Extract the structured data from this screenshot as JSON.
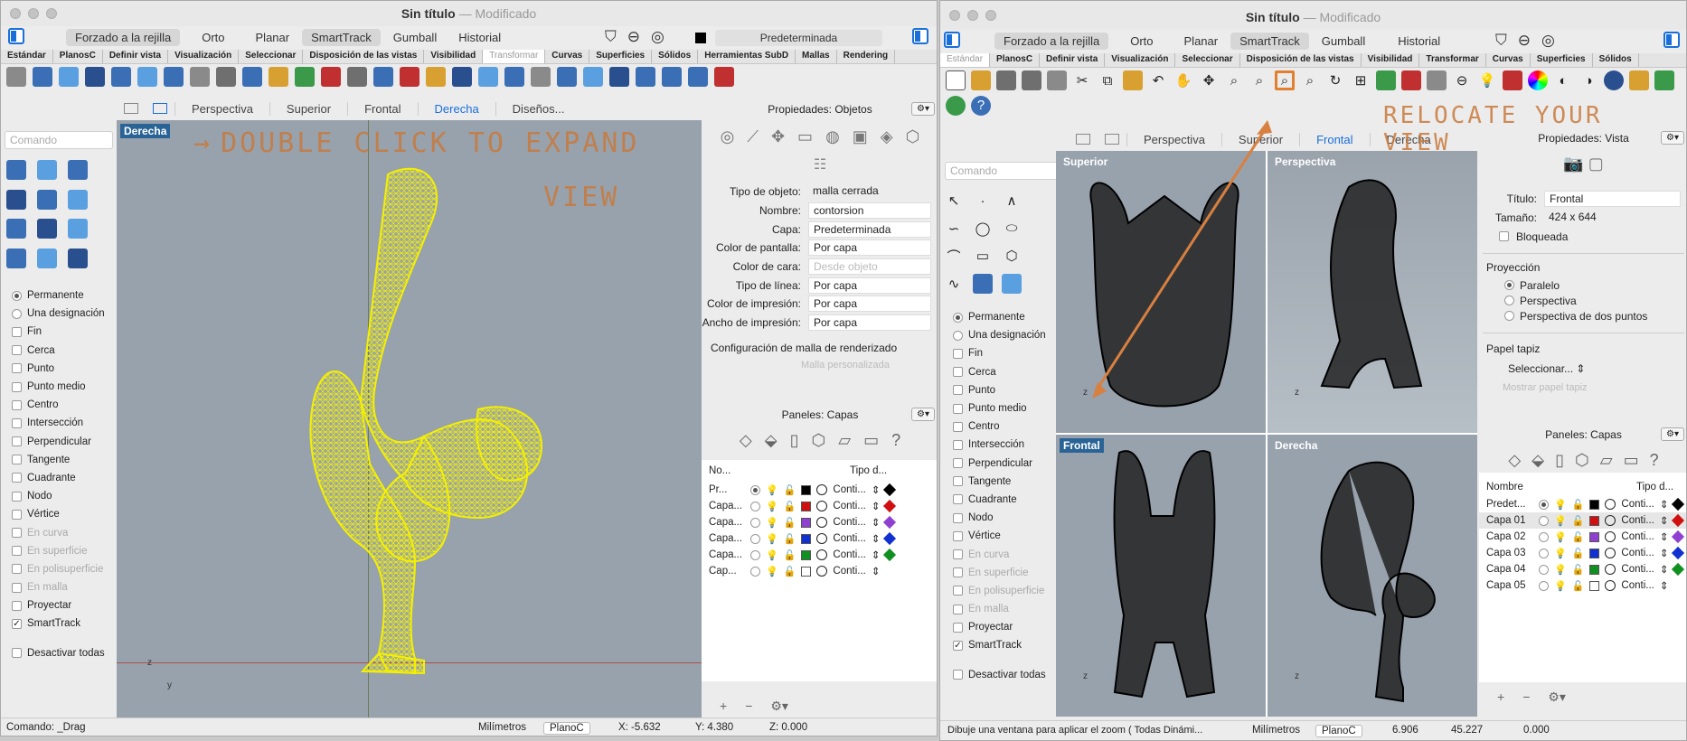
{
  "left_window": {
    "title": "Sin título",
    "modified": "— Modificado",
    "status_buttons": [
      "Forzado a la rejilla",
      "Orto",
      "Planar",
      "SmartTrack",
      "Gumball",
      "Historial"
    ],
    "layer": "Predeterminada",
    "tabs": [
      "Estándar",
      "PlanosC",
      "Definir vista",
      "Visualización",
      "Seleccionar",
      "Disposición de las vistas",
      "Visibilidad",
      "Transformar",
      "Curvas",
      "Superficies",
      "Sólidos",
      "Herramientas SubD",
      "Mallas",
      "Rendering"
    ],
    "active_tab": "Transformar",
    "view_tabs": [
      "Perspectiva",
      "Superior",
      "Frontal",
      "Derecha",
      "Diseños..."
    ],
    "active_view_tab": "Derecha",
    "command_placeholder": "Comando",
    "viewport_label": "Derecha",
    "annotation_line1": "DOUBLE CLICK TO EXPAND",
    "annotation_line2": "VIEW",
    "props_title": "Propiedades: Objetos",
    "props": [
      {
        "label": "Tipo de objeto:",
        "value": "malla cerrada",
        "plain": true
      },
      {
        "label": "Nombre:",
        "value": "contorsion"
      },
      {
        "label": "Capa:",
        "value": "Predeterminada"
      },
      {
        "label": "Color de pantalla:",
        "value": "Por capa"
      },
      {
        "label": "Color de cara:",
        "value": "Desde objeto",
        "disabled": true
      },
      {
        "label": "Tipo de línea:",
        "value": "Por capa"
      },
      {
        "label": "Color de impresión:",
        "value": "Por capa"
      },
      {
        "label": "Ancho de impresión:",
        "value": "Por capa"
      }
    ],
    "mesh_config": "Configuración de malla de renderizado",
    "mesh_custom": "Malla personalizada",
    "layers_title": "Paneles: Capas",
    "layer_headers": [
      "No...",
      "Tipo d..."
    ],
    "layer_rows": [
      {
        "name": "Pr...",
        "color": "#000000",
        "type": "Conti..."
      },
      {
        "name": "Capa...",
        "color": "#d01010",
        "type": "Conti..."
      },
      {
        "name": "Capa...",
        "color": "#9040d0",
        "type": "Conti..."
      },
      {
        "name": "Capa...",
        "color": "#1030d0",
        "type": "Conti..."
      },
      {
        "name": "Capa...",
        "color": "#109020",
        "type": "Conti..."
      },
      {
        "name": "Cap...",
        "color": "#ffffff",
        "type": "Conti..."
      }
    ],
    "status_command": "Comando: _Drag",
    "units": "Milímetros",
    "cplane": "PlanoC",
    "x": "X: -5.632",
    "y": "Y: 4.380",
    "z": "Z: 0.000"
  },
  "snaps": {
    "radio": [
      "Permanente",
      "Una designación"
    ],
    "items": [
      {
        "label": "Fin",
        "disabled": false,
        "checked": false
      },
      {
        "label": "Cerca",
        "disabled": false,
        "checked": false
      },
      {
        "label": "Punto",
        "disabled": false,
        "checked": false
      },
      {
        "label": "Punto medio",
        "disabled": false,
        "checked": false
      },
      {
        "label": "Centro",
        "disabled": false,
        "checked": false
      },
      {
        "label": "Intersección",
        "disabled": false,
        "checked": false
      },
      {
        "label": "Perpendicular",
        "disabled": false,
        "checked": false
      },
      {
        "label": "Tangente",
        "disabled": false,
        "checked": false
      },
      {
        "label": "Cuadrante",
        "disabled": false,
        "checked": false
      },
      {
        "label": "Nodo",
        "disabled": false,
        "checked": false
      },
      {
        "label": "Vértice",
        "disabled": false,
        "checked": false
      },
      {
        "label": "En curva",
        "disabled": true,
        "checked": false
      },
      {
        "label": "En superficie",
        "disabled": true,
        "checked": false
      },
      {
        "label": "En polisuperficie",
        "disabled": true,
        "checked": false
      },
      {
        "label": "En malla",
        "disabled": true,
        "checked": false
      },
      {
        "label": "Proyectar",
        "disabled": false,
        "checked": false
      },
      {
        "label": "SmartTrack",
        "disabled": false,
        "checked": true
      }
    ],
    "disable_all": "Desactivar todas"
  },
  "right_window": {
    "title": "Sin título",
    "modified": "— Modificado",
    "status_buttons": [
      "Forzado a la rejilla",
      "Orto",
      "Planar",
      "SmartTrack",
      "Gumball",
      "Historial"
    ],
    "tabs": [
      "Estándar",
      "PlanosC",
      "Definir vista",
      "Visualización",
      "Seleccionar",
      "Disposición de las vistas",
      "Visibilidad",
      "Transformar",
      "Curvas",
      "Superficies",
      "Sólidos"
    ],
    "active_tab": "Estándar",
    "view_tabs": [
      "Perspectiva",
      "Superior",
      "Frontal",
      "Derecha"
    ],
    "active_view_tab": "Frontal",
    "command_placeholder": "Comando",
    "viewports": [
      "Superior",
      "Perspectiva",
      "Frontal",
      "Derecha"
    ],
    "active_viewport": "Frontal",
    "annotation": "RELOCATE YOUR VIEW",
    "props_title": "Propiedades: Vista",
    "view_title_label": "Título:",
    "view_title": "Frontal",
    "size_label": "Tamaño:",
    "size": "424 x 644",
    "locked": "Bloqueada",
    "projection": "Proyección",
    "projection_options": [
      "Paralelo",
      "Perspectiva",
      "Perspectiva de dos puntos"
    ],
    "projection_selected": 0,
    "wallpaper": "Papel tapiz",
    "select": "Seleccionar...",
    "show_wallpaper": "Mostrar papel tapiz",
    "layers_title": "Paneles: Capas",
    "layer_headers": [
      "Nombre",
      "Tipo d..."
    ],
    "layer_rows": [
      {
        "name": "Predet...",
        "color": "#000000",
        "type": "Conti..."
      },
      {
        "name": "Capa 01",
        "color": "#d01010",
        "type": "Conti..."
      },
      {
        "name": "Capa 02",
        "color": "#9040d0",
        "type": "Conti..."
      },
      {
        "name": "Capa 03",
        "color": "#1030d0",
        "type": "Conti..."
      },
      {
        "name": "Capa 04",
        "color": "#109020",
        "type": "Conti..."
      },
      {
        "name": "Capa 05",
        "color": "#ffffff",
        "type": "Conti..."
      }
    ],
    "status_command": "Dibuje una ventana para aplicar el zoom ( Todas Dinámi...",
    "units": "Milímetros",
    "cplane": "PlanoC",
    "x": "6.906",
    "y": "45.227",
    "z": "0.000"
  }
}
